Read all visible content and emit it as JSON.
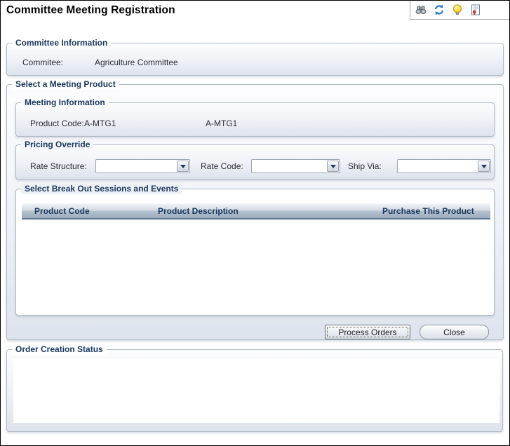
{
  "window": {
    "title": "Committee Meeting Registration"
  },
  "toolbar": {
    "icons": [
      {
        "name": "find-binoculars-icon"
      },
      {
        "name": "refresh-icon"
      },
      {
        "name": "help-lightbulb-icon"
      },
      {
        "name": "report-icon"
      }
    ]
  },
  "committee_info": {
    "legend": "Committee Information",
    "committee_label": "Commitee:",
    "committee_value": "Agriculture Committee"
  },
  "meeting_product": {
    "legend": "Select a Meeting Product",
    "meeting_information": {
      "legend": "Meeting Information",
      "product_code_label": "Product Code:",
      "product_code": "A-MTG1",
      "product_code_display": "A-MTG1"
    },
    "pricing_override": {
      "legend": "Pricing Override",
      "rate_structure": {
        "label": "Rate Structure:",
        "value": ""
      },
      "rate_code": {
        "label": "Rate Code:",
        "value": ""
      },
      "ship_via": {
        "label": "Ship Via:",
        "value": ""
      }
    },
    "sessions": {
      "legend": "Select Break Out Sessions and Events",
      "columns": [
        "Product Code",
        "Product Description",
        "Purchase This Product"
      ],
      "rows": []
    },
    "actions": {
      "process_orders": "Process Orders",
      "close": "Close"
    }
  },
  "order_status": {
    "legend": "Order Creation Status",
    "content": ""
  },
  "colors": {
    "legend_text": "#17375e",
    "panel_border": "#aeb9c8",
    "panel_gradient_top": "#fdfdfe",
    "panel_gradient_bottom": "#dde3ed",
    "table_header_text": "#17375e",
    "table_header_rule": "#5f7894",
    "refresh_icon_blue": "#2f7ed4",
    "lightbulb_yellow": "#f5c518",
    "report_seal_red": "#d23b2f"
  }
}
